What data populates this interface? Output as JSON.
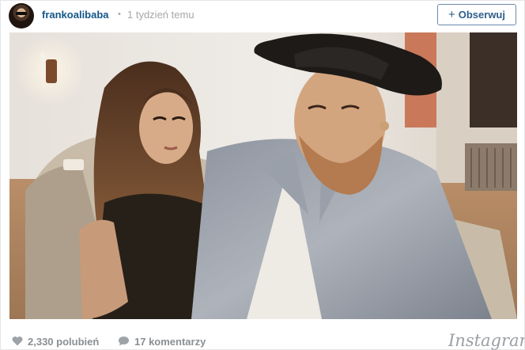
{
  "post": {
    "username": "frankoalibaba",
    "separator": "•",
    "time_ago": "1 tydzień temu",
    "follow_label": "Obserwuj",
    "follow_icon": "plus-icon"
  },
  "photo": {
    "subject": "photo-two-people-seated"
  },
  "footer": {
    "likes": "2,330 polubień",
    "likes_icon": "heart-icon",
    "comments": "17 komentarzy",
    "comments_icon": "speech-bubble-icon",
    "brand": "Instagram"
  },
  "colors": {
    "username": "#125688",
    "meta": "#a5a7aa",
    "follow_border": "#6b8cab",
    "follow_text": "#2f5e8a",
    "counts": "#8a8f93"
  }
}
